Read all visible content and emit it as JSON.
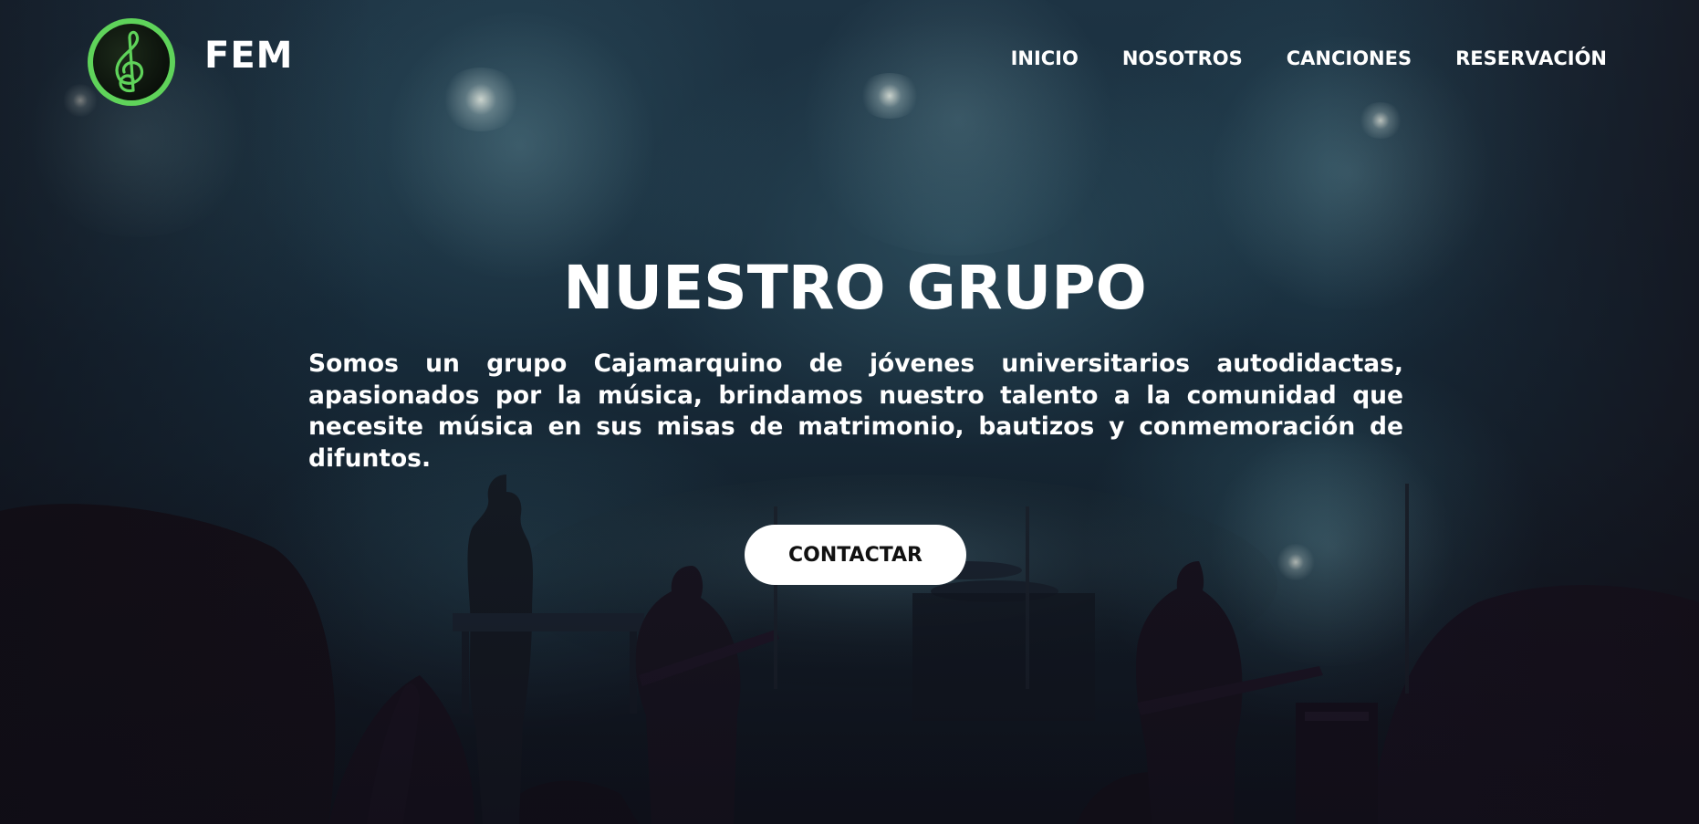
{
  "header": {
    "brand": "FEM",
    "logo_icon": "treble-clef-icon",
    "nav": [
      {
        "label": "INICIO"
      },
      {
        "label": "NOSOTROS"
      },
      {
        "label": "CANCIONES"
      },
      {
        "label": "RESERVACIÓN"
      }
    ]
  },
  "hero": {
    "title": "NUESTRO GRUPO",
    "description": "Somos un grupo Cajamarquino de jóvenes universitarios autodidactas, apasionados por la música, brindamos nuestro talento a la comunidad que necesite música en sus misas de matrimonio, bautizos y conmemoración de difuntos.",
    "cta_label": "CONTACTAR"
  },
  "colors": {
    "logo_accent": "#5fd35a",
    "text": "#ffffff",
    "button_bg": "#ffffff",
    "button_text": "#111111"
  }
}
